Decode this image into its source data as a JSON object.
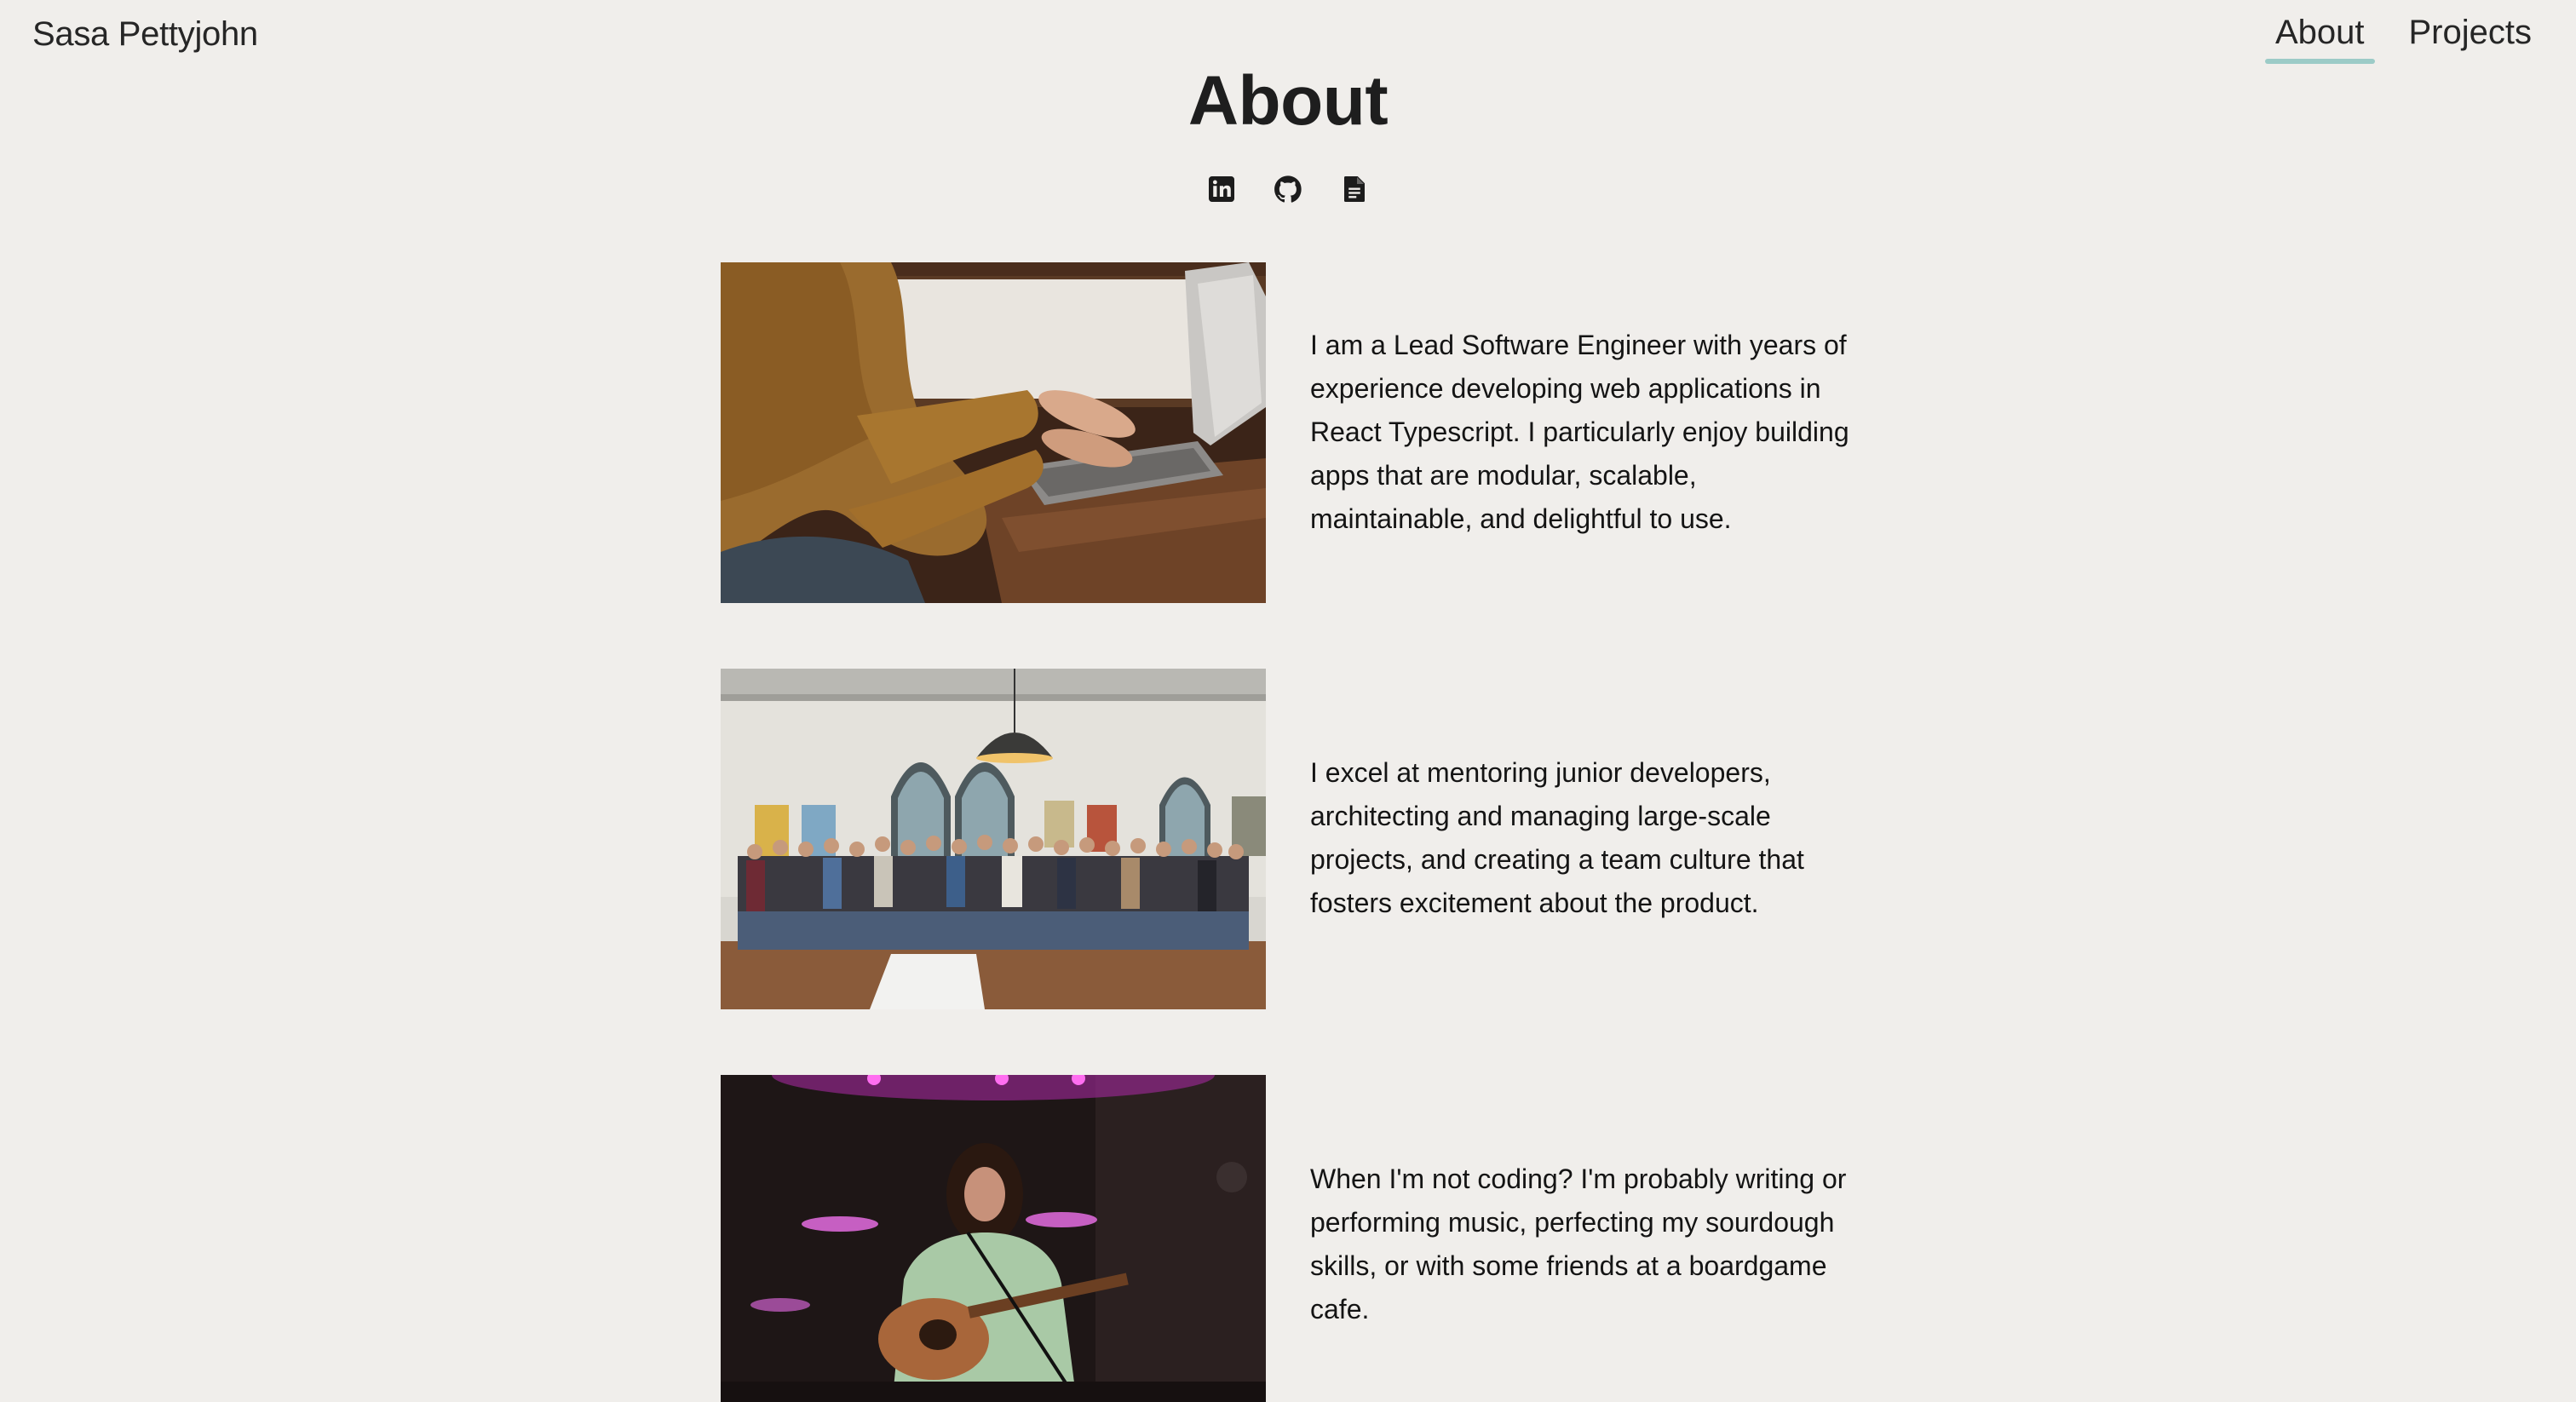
{
  "header": {
    "site_name": "Sasa Pettyjohn",
    "nav": [
      {
        "label": "About",
        "active": true
      },
      {
        "label": "Projects",
        "active": false
      }
    ],
    "accent_color": "#9ccbc7"
  },
  "main": {
    "title": "About",
    "social_icons": [
      "linkedin-icon",
      "github-icon",
      "resume-document-icon"
    ],
    "sections": [
      {
        "image": "person typing on laptop",
        "text": "I am a Lead Software Engineer with years of experience developing web applications in React Typescript. I particularly enjoy building apps that are modular, scalable, maintainable, and delightful to use."
      },
      {
        "image": "team group photo",
        "text": "I excel at mentoring junior developers, architecting and managing large-scale projects, and creating a team culture that fosters excitement about the product."
      },
      {
        "image": "performing music with guitar",
        "text": "When I'm not coding? I'm probably writing or performing music, perfecting my sourdough skills, or with some friends at a boardgame cafe."
      }
    ]
  }
}
